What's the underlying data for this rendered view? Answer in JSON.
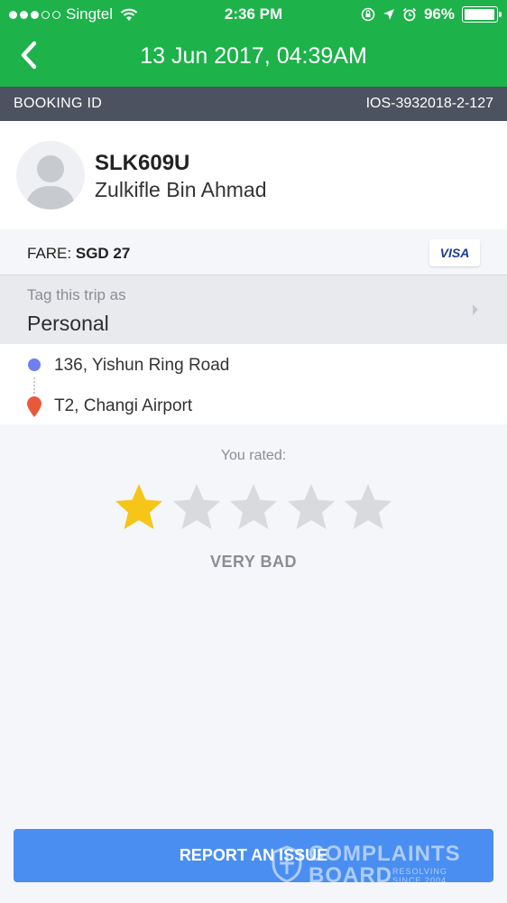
{
  "status_bar": {
    "carrier": "Singtel",
    "time": "2:36 PM",
    "battery": "96%",
    "battery_level": 0.96
  },
  "header": {
    "title": "13 Jun 2017, 04:39AM"
  },
  "booking": {
    "label": "BOOKING ID",
    "value": "IOS-3932018-2-127"
  },
  "driver": {
    "plate": "SLK609U",
    "name": "Zulkifle Bin Ahmad"
  },
  "fare": {
    "label": "FARE:",
    "value": "SGD 27",
    "payment": "VISA"
  },
  "tag": {
    "label": "Tag this trip as",
    "value": "Personal"
  },
  "route": {
    "pickup": "136, Yishun Ring Road",
    "dropoff": "T2, Changi Airport"
  },
  "rating": {
    "label": "You rated:",
    "stars": 1,
    "max_stars": 5,
    "text": "VERY BAD",
    "filled_color": "#f5c518",
    "empty_color": "#d9dadd"
  },
  "actions": {
    "report_label": "REPORT AN ISSUE"
  },
  "watermark": {
    "line1": "COMPLAINTS",
    "line2": "BOARD",
    "tag1": "RESOLVING",
    "tag2": "SINCE 2004"
  },
  "colors": {
    "header": "#1db24a",
    "booking_bar": "#4c5260",
    "button": "#4a8ef2",
    "pickup": "#6f7ff0",
    "dropoff": "#e8593c"
  }
}
